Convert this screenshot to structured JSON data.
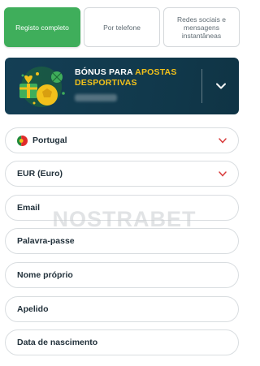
{
  "tabs": [
    {
      "label": "Registo completo",
      "active": true
    },
    {
      "label": "Por telefone",
      "active": false
    },
    {
      "label": "Redes sociais e mensagens instantâneas",
      "active": false
    }
  ],
  "bonus": {
    "title_white": "BÓNUS PARA",
    "title_yellow_1": "APOSTAS",
    "title_yellow_2": "DESPORTIVAS",
    "icon": "sports-ball-gift-icon",
    "expand_icon": "chevron-down-icon",
    "colors": {
      "background": "#143f55",
      "highlight": "#f2c11b"
    }
  },
  "form": {
    "country": {
      "value": "Portugal",
      "flag_icon": "portugal-flag-icon"
    },
    "currency": {
      "value": "EUR (Euro)"
    },
    "email": {
      "placeholder": "Email"
    },
    "password": {
      "placeholder": "Palavra-passe"
    },
    "first_name": {
      "placeholder": "Nome próprio"
    },
    "last_name": {
      "placeholder": "Apelido"
    },
    "birth_date": {
      "placeholder": "Data de nascimento"
    },
    "dropdown_icon": "chevron-down-red-icon"
  },
  "watermark": {
    "text": "NOSTRABET"
  },
  "colors": {
    "accent": "#3fae5b",
    "dropdown": "#d83b3b"
  }
}
